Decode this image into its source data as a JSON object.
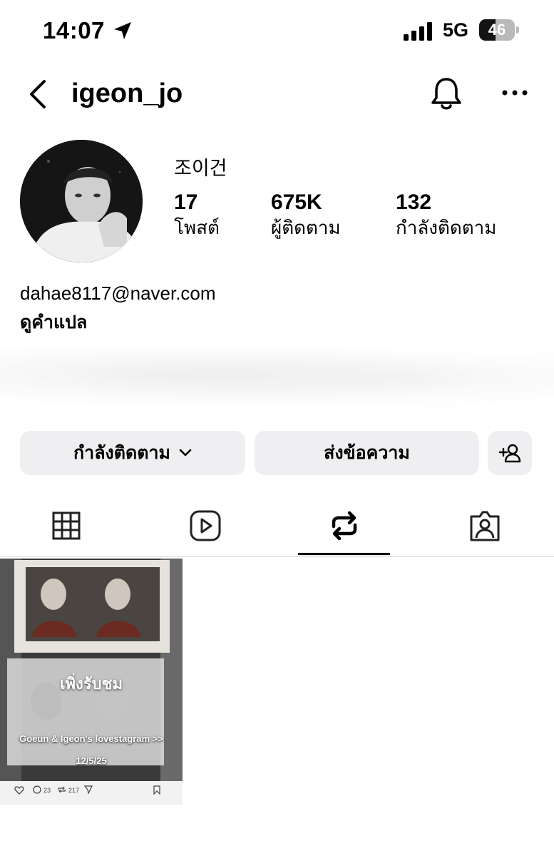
{
  "status_bar": {
    "time": "14:07",
    "network": "5G",
    "battery": {
      "text": "46",
      "level": 0.46
    }
  },
  "header": {
    "username": "igeon_jo",
    "icons": [
      "back-chevron-icon",
      "bell-icon",
      "more-icon"
    ]
  },
  "profile": {
    "display_name": "조이건",
    "stats": [
      {
        "value": "17",
        "label": "โพสต์"
      },
      {
        "value": "675K",
        "label": "ผู้ติดตาม"
      },
      {
        "value": "132",
        "label": "กำลังติดตาม"
      }
    ],
    "email": "dahae8117@naver.com",
    "see_translation": "ดูคำแปล"
  },
  "actions": {
    "following_label": "กำลังติดตาม",
    "message_label": "ส่งข้อความ"
  },
  "tabs": [
    {
      "icon": "grid-icon",
      "active": false
    },
    {
      "icon": "reels-icon",
      "active": false
    },
    {
      "icon": "repost-icon",
      "active": true
    },
    {
      "icon": "tagged-icon",
      "active": false
    }
  ],
  "post": {
    "label": "เพิ่งรับชม",
    "caption": "Goeun & Igeon's lovestagram >>",
    "date": "12/5/25",
    "comments": "23",
    "reposts": "217"
  },
  "colors": {
    "button_bg": "#efeff1",
    "divider": "#dbdbdb"
  }
}
